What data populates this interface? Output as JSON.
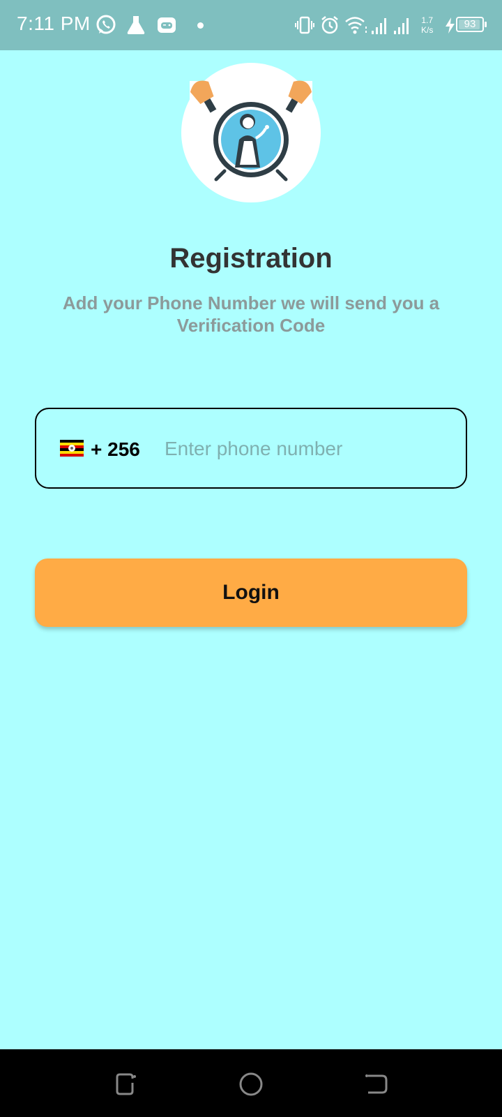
{
  "status_bar": {
    "time": "7:11 PM",
    "net_speed_value": "1.7",
    "net_speed_unit": "K/s",
    "battery_level": "93",
    "battery_fraction": 0.93,
    "icons": [
      "whatsapp-icon",
      "lab-flask-icon",
      "game-controller-icon",
      "notification-dot-icon",
      "vibrate-icon",
      "alarm-icon",
      "wifi-icon",
      "signal-icon",
      "signal-icon-2",
      "charging-icon",
      "battery-icon"
    ]
  },
  "logo": {
    "icon": "maid-cleaning-logo"
  },
  "screen": {
    "title": "Registration",
    "subtitle": "Add your Phone Number we will send you a Verification Code"
  },
  "phone_field": {
    "country_flag": "uganda-flag",
    "dial_code": "+ 256",
    "value": "",
    "placeholder": "Enter phone number"
  },
  "login_button": {
    "label": "Login"
  },
  "nav_bar": {
    "icons": [
      "recents-icon",
      "home-icon",
      "back-icon"
    ]
  },
  "colors": {
    "background": "#ADFFFF",
    "status_bar": "#7FBFBF",
    "accent": "#FFAB45",
    "title": "#333333",
    "subtitle": "#8C9A9A"
  }
}
